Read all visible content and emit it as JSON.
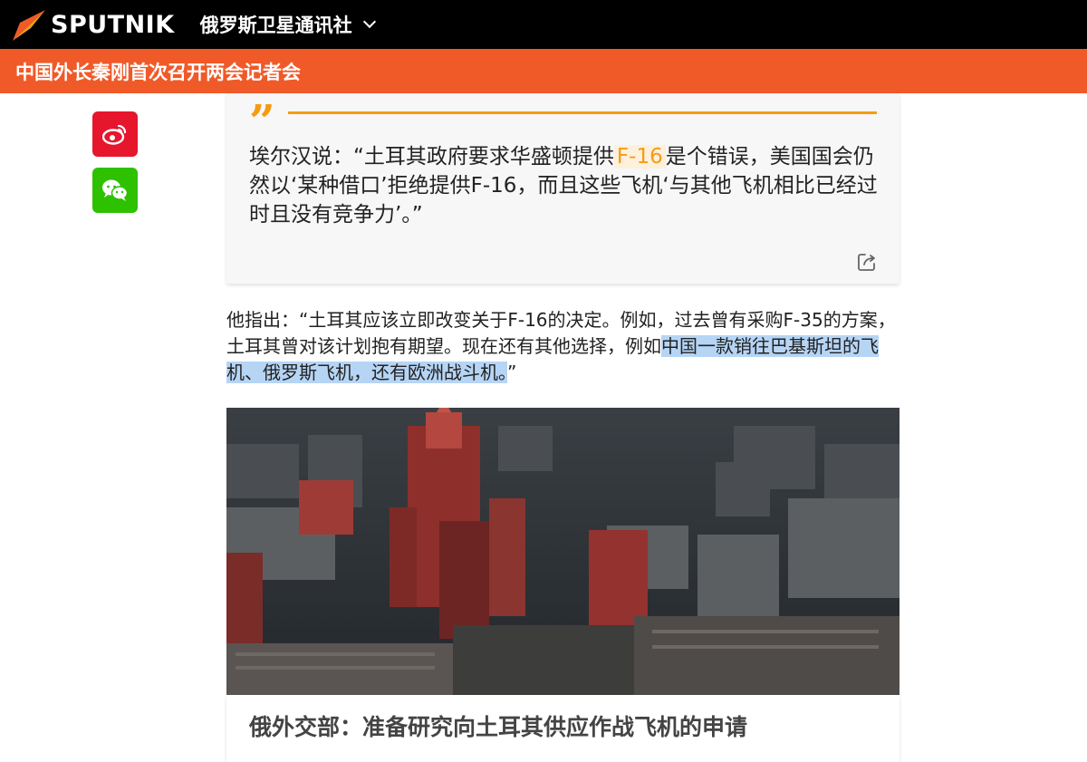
{
  "header": {
    "brand": "SPUTNIK",
    "edition": "俄罗斯卫星通讯社",
    "brand_color": "#f05a28"
  },
  "banner": {
    "title": "中国外长秦刚首次召开两会记者会"
  },
  "share": {
    "weibo_icon": "weibo-icon",
    "wechat_icon": "wechat-icon"
  },
  "quote": {
    "text_before": "埃尔汉说：“土耳其政府要求华盛顿提供",
    "highlight": "F-16",
    "text_after": "是个错误，美国国会仍然以‘某种借口’拒绝提供F-16，而且这些飞机‘与其他飞机相比已经过时且没有竞争力’。”",
    "accent": "#f39c12"
  },
  "paragraph": {
    "text_before": "他指出：“土耳其应该立即改变关于F-16的决定。例如，过去曾有采购F-35的方案，土耳其曾对该计划抱有期望。现在还有其他选择，例如",
    "selected": "中国一款销往巴基斯坦的飞机、俄罗斯飞机，还有欧洲战斗机。",
    "text_after": "”"
  },
  "related": {
    "caption": "俄外交部：准备研究向土耳其供应作战飞机的申请"
  }
}
